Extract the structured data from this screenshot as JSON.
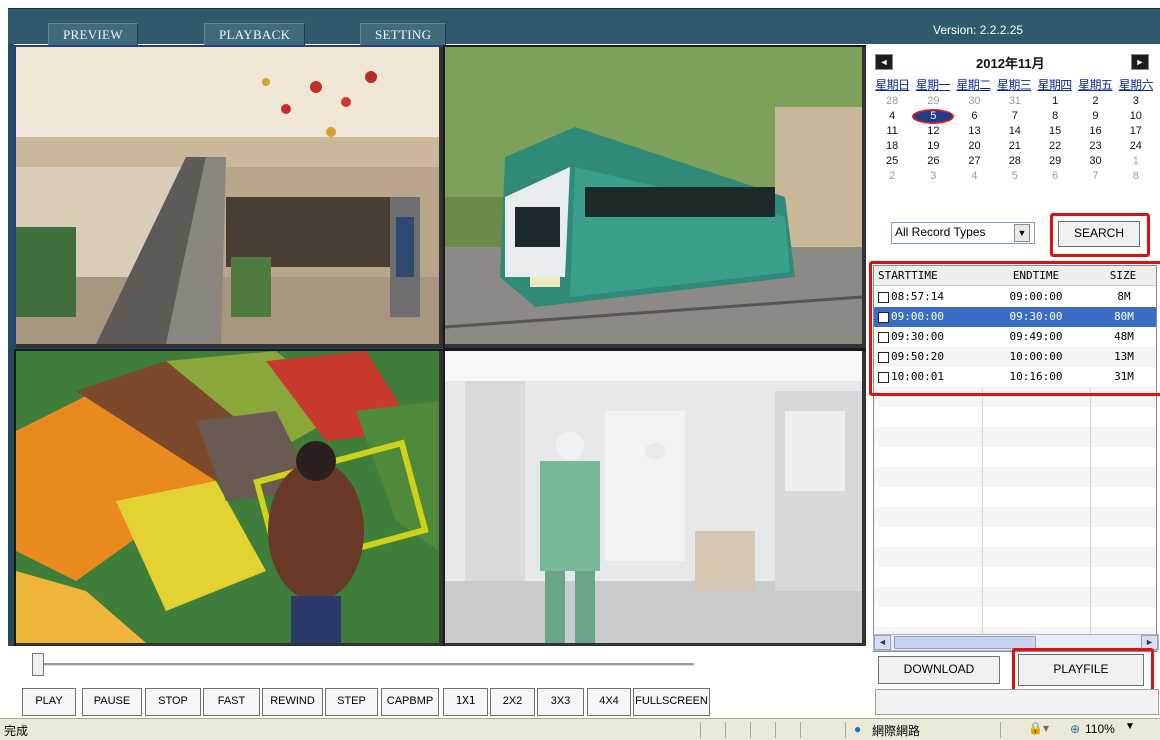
{
  "tabs": [
    {
      "label": "PREVIEW"
    },
    {
      "label": "PLAYBACK"
    },
    {
      "label": "SETTING"
    }
  ],
  "version": "Version: 2.2.2.25",
  "calendar": {
    "title": "2012年11月",
    "prev": "◄",
    "next": "►",
    "weekdays": [
      "星期日",
      "星期一",
      "星期二",
      "星期三",
      "星期四",
      "星期五",
      "星期六"
    ],
    "weeks": [
      [
        "28",
        "29",
        "30",
        "31",
        "1",
        "2",
        "3"
      ],
      [
        "4",
        "5",
        "6",
        "7",
        "8",
        "9",
        "10"
      ],
      [
        "11",
        "12",
        "13",
        "14",
        "15",
        "16",
        "17"
      ],
      [
        "18",
        "19",
        "20",
        "21",
        "22",
        "23",
        "24"
      ],
      [
        "25",
        "26",
        "27",
        "28",
        "29",
        "30",
        "1"
      ],
      [
        "2",
        "3",
        "4",
        "5",
        "6",
        "7",
        "8"
      ]
    ]
  },
  "record_type": "All Record Types",
  "search_label": "SEARCH",
  "table": {
    "headers": [
      "STARTTIME",
      "ENDTIME",
      "SIZE"
    ],
    "rows": [
      {
        "start": "08:57:14",
        "end": "09:00:00",
        "size": "8M"
      },
      {
        "start": "09:00:00",
        "end": "09:30:00",
        "size": "80M"
      },
      {
        "start": "09:30:00",
        "end": "09:49:00",
        "size": "48M"
      },
      {
        "start": "09:50:20",
        "end": "10:00:00",
        "size": "13M"
      },
      {
        "start": "10:00:01",
        "end": "10:16:00",
        "size": "31M"
      }
    ]
  },
  "download_label": "DOWNLOAD",
  "playfile_label": "PLAYFILE",
  "controls": [
    "PLAY",
    "PAUSE",
    "STOP",
    "FAST",
    "REWIND",
    "STEP",
    "CAPBMP",
    "1X1",
    "2X2",
    "3X3",
    "4X4",
    "FULLSCREEN"
  ],
  "statusbar": {
    "left": "完成",
    "zone": "網際網路",
    "zoom": "110%"
  },
  "colors": {
    "header": "#2e5a6b",
    "selection": "#3a6cc6",
    "highlight": "#e01010"
  }
}
